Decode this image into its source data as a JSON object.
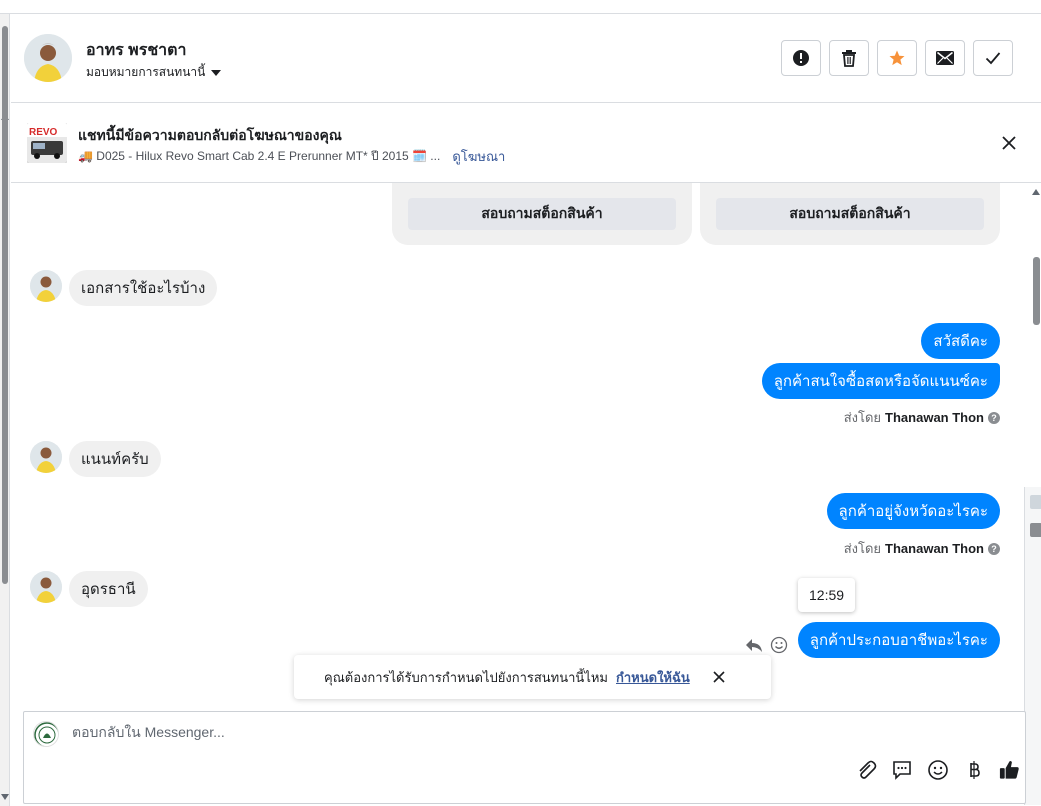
{
  "header": {
    "contact_name": "อาทร พรชาตา",
    "assign_label": "มอบหมายการสนทนานี้",
    "buttons": [
      {
        "name": "report",
        "icon": "alert-icon"
      },
      {
        "name": "delete",
        "icon": "trash-icon"
      },
      {
        "name": "star",
        "icon": "star-icon",
        "color": "#f7923a"
      },
      {
        "name": "mail",
        "icon": "mail-icon"
      },
      {
        "name": "done",
        "icon": "check-icon"
      }
    ]
  },
  "ad_banner": {
    "title": "แชทนี้มีข้อความตอบกลับต่อโฆษณาของคุณ",
    "subtitle": "🚚 D025 - Hilux Revo Smart Cab 2.4 E Prerunner MT* ปี 2015 🗓️ ...",
    "link_label": "ดูโฆษณา",
    "thumb_label": "REVO"
  },
  "conversation": {
    "card_buttons": [
      "สอบถามสต็อกสินค้า",
      "สอบถามสต็อกสินค้า"
    ],
    "messages": [
      {
        "from": "customer",
        "text": "เอกสารใช้อะไรบ้าง"
      },
      {
        "from": "page",
        "text": "สวัสดีคะ"
      },
      {
        "from": "page",
        "text": "ลูกค้าสนใจซื้อสดหรือจัดแนนซ์คะ"
      },
      {
        "from": "customer",
        "text": "แนนท์ครับ"
      },
      {
        "from": "page",
        "text": "ลูกค้าอยู่จังหวัดอะไรคะ"
      },
      {
        "from": "customer",
        "text": "อุดรธานี"
      },
      {
        "from": "page",
        "text": "ลูกค้าประกอบอาชีพอะไรคะ"
      }
    ],
    "sent_by_prefix": "ส่งโดย",
    "sent_by_name": "Thanawan Thon",
    "tooltip_time": "12:59"
  },
  "toast": {
    "text": "คุณต้องการได้รับการกำหนดไปยังการสนทนานี้ไหม",
    "link": "กำหนดให้ฉัน"
  },
  "composer": {
    "placeholder": "ตอบกลับใน Messenger...",
    "tools": [
      "attach-icon",
      "saved-reply-icon",
      "emoji-icon",
      "baht-icon",
      "thumbs-up-icon"
    ]
  },
  "colors": {
    "outgoing_bubble": "#0084ff",
    "incoming_bubble": "#f0f0f0",
    "link": "#385898",
    "star": "#f7923a"
  }
}
